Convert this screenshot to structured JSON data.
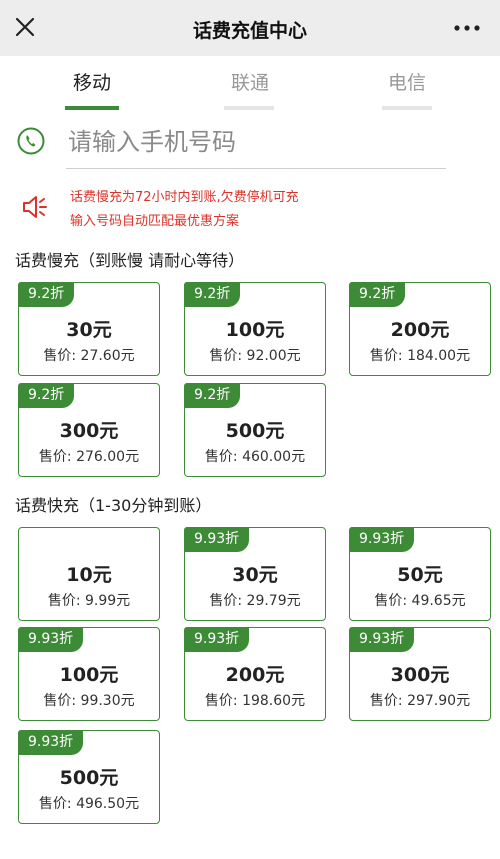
{
  "header": {
    "title": "话费充值中心"
  },
  "tabs": [
    {
      "label": "移动"
    },
    {
      "label": "联通"
    },
    {
      "label": "电信"
    }
  ],
  "phone": {
    "placeholder": "请输入手机号码"
  },
  "notice": {
    "line1": "话费慢充为72小时内到账,欠费停机可充",
    "line2": "输入号码自动匹配最优惠方案"
  },
  "colors": {
    "accent": "#3d8b37",
    "notice": "#d9342b"
  },
  "slow": {
    "title": "话费慢充（到账慢 请耐心等待）",
    "cards": [
      {
        "badge": "9.2折",
        "face": "30元",
        "price": "售价: 27.60元"
      },
      {
        "badge": "9.2折",
        "face": "100元",
        "price": "售价: 92.00元"
      },
      {
        "badge": "9.2折",
        "face": "200元",
        "price": "售价: 184.00元"
      },
      {
        "badge": "9.2折",
        "face": "300元",
        "price": "售价: 276.00元"
      },
      {
        "badge": "9.2折",
        "face": "500元",
        "price": "售价: 460.00元"
      }
    ]
  },
  "fast": {
    "title": "话费快充（1-30分钟到账）",
    "cards": [
      {
        "badge": "",
        "face": "10元",
        "price": "售价: 9.99元"
      },
      {
        "badge": "9.93折",
        "face": "30元",
        "price": "售价: 29.79元"
      },
      {
        "badge": "9.93折",
        "face": "50元",
        "price": "售价: 49.65元"
      },
      {
        "badge": "9.93折",
        "face": "100元",
        "price": "售价: 99.30元"
      },
      {
        "badge": "9.93折",
        "face": "200元",
        "price": "售价: 198.60元"
      },
      {
        "badge": "9.93折",
        "face": "300元",
        "price": "售价: 297.90元"
      },
      {
        "badge": "9.93折",
        "face": "500元",
        "price": "售价: 496.50元"
      }
    ]
  }
}
